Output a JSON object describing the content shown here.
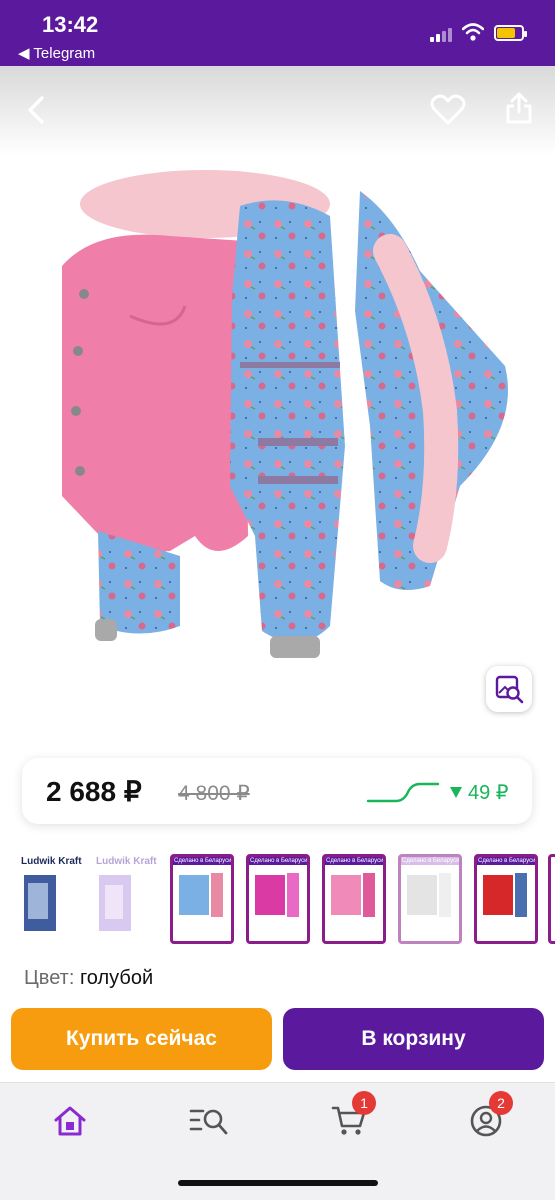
{
  "status_bar": {
    "time": "13:42",
    "back_app": "◀ Telegram",
    "background": "#5b1a9e"
  },
  "product_image": {
    "icons": [
      "back-arrow-icon",
      "heart-icon",
      "share-icon",
      "image-search-icon"
    ]
  },
  "price": {
    "current": "2 688 ₽",
    "old": "4 800 ₽",
    "drop": "49 ₽",
    "drop_color": "#19b55a"
  },
  "thumbnails": {
    "first_brand": "Ludwik Kraft",
    "second_brand": "Ludwik Kraft",
    "banner": "Сделано в Беларуси"
  },
  "color": {
    "label": "Цвет:",
    "value": "голубой"
  },
  "actions": {
    "buy_now": "Купить сейчас",
    "add_to_cart": "В корзину",
    "buy_color": "#f79c0e",
    "cart_color": "#5b1a9e"
  },
  "tabbar": {
    "items": [
      {
        "icon": "home-icon",
        "active": true
      },
      {
        "icon": "catalog-search-icon",
        "active": false
      },
      {
        "icon": "cart-icon",
        "badge": "1"
      },
      {
        "icon": "profile-icon",
        "badge": "2"
      }
    ],
    "accent": "#8a2bd1"
  }
}
